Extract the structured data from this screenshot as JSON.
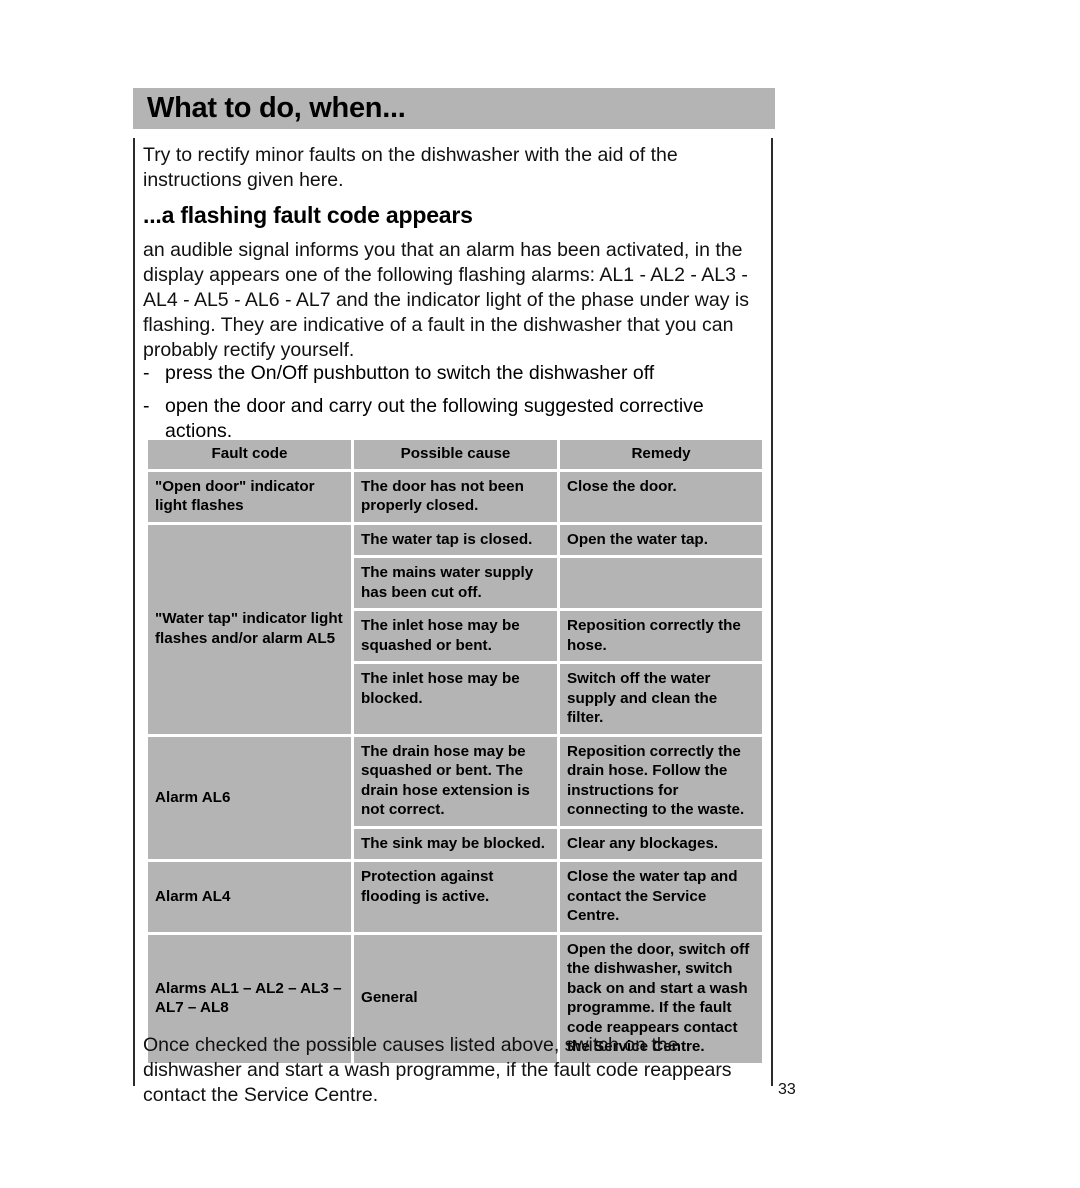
{
  "header": {
    "title": "What to do, when..."
  },
  "intro": "Try to rectify minor faults on the dishwasher with the aid of the instructions given here.",
  "subhead": "...a flashing fault code appears",
  "lead": "an audible signal informs you that an alarm has been activated, in the display appears one of the following flashing alarms: AL1 - AL2 - AL3 - AL4 - AL5 - AL6 - AL7 and the indicator light of the phase under way is flashing. They are indicative of a fault in the dishwasher that you can probably rectify yourself.",
  "bullets": [
    {
      "dash": "-",
      "text": "press the On/Off pushbutton to switch the dishwasher off"
    },
    {
      "dash": "-",
      "text": "open the door and carry out the following suggested corrective actions."
    }
  ],
  "table": {
    "headers": [
      "Fault code",
      "Possible cause",
      "Remedy"
    ],
    "rows": [
      {
        "fault": "\"Open door\" indicator light flashes",
        "fault_rowspan": 1,
        "entries": [
          {
            "cause": "The door has not been properly closed.",
            "remedy": "Close the door."
          }
        ]
      },
      {
        "fault": "\"Water tap\" indicator light flashes and/or alarm AL5",
        "fault_rowspan": 4,
        "entries": [
          {
            "cause": "The water tap is closed.",
            "remedy": "Open the water tap."
          },
          {
            "cause": "The mains water supply has been cut off.",
            "remedy": ""
          },
          {
            "cause": "The inlet hose may be squashed or bent.",
            "remedy": "Reposition correctly the hose."
          },
          {
            "cause": "The inlet hose may be blocked.",
            "remedy": "Switch off the water supply and clean the filter."
          }
        ]
      },
      {
        "fault": "Alarm AL6",
        "fault_rowspan": 2,
        "entries": [
          {
            "cause": "The drain hose may be squashed or bent. The drain hose extension is not correct.",
            "remedy": "Reposition correctly the drain hose. Follow the instructions for connecting to the waste."
          },
          {
            "cause": "The sink may be blocked.",
            "remedy": "Clear any blockages."
          }
        ]
      },
      {
        "fault": "Alarm AL4",
        "fault_rowspan": 1,
        "entries": [
          {
            "cause": "Protection against flooding is active.",
            "remedy": "Close the water tap and contact the Service Centre."
          }
        ]
      },
      {
        "fault": "Alarms AL1 – AL2 – AL3 – AL7 – AL8",
        "fault_rowspan": 1,
        "entries": [
          {
            "cause": "General",
            "remedy": "Open the door, switch off the dishwasher, switch back on and start a wash programme. If the fault code reappears contact the Service Centre."
          }
        ]
      }
    ]
  },
  "closing": "Once checked the possible causes listed above, switch on the dishwasher and start a wash programme, if the fault code reappears contact the Service Centre.",
  "page_number": "33",
  "colors": {
    "band_gray": "#b4b4b4",
    "cell_gray": "#b4b4b4",
    "rule": "#2b2b2b",
    "text": "#000000"
  }
}
